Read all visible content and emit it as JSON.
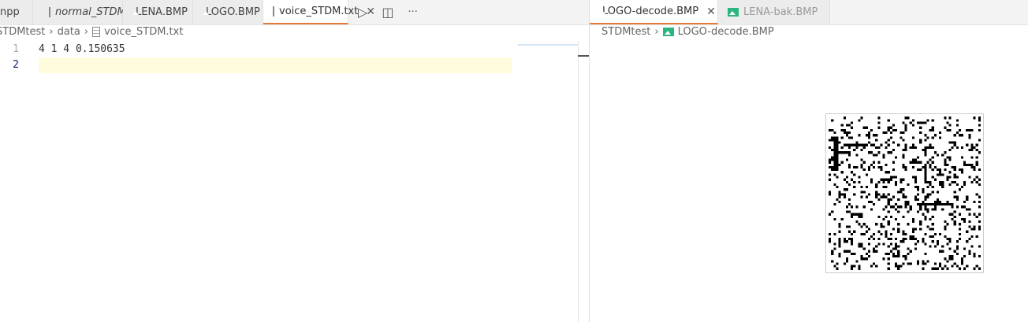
{
  "left_tabs": [
    {
      "label": "npp",
      "icon": "none"
    },
    {
      "label": "normal_STDM.txt",
      "icon": "file-icon",
      "italic": true
    },
    {
      "label": "LENA.BMP",
      "icon": "image-icon"
    },
    {
      "label": "LOGO.BMP",
      "icon": "image-icon"
    },
    {
      "label": "voice_STDM.txt",
      "icon": "file-icon",
      "active": true
    }
  ],
  "left_breadcrumb": [
    "STDMtest",
    "data",
    "voice_STDM.txt"
  ],
  "editor": {
    "lines": [
      {
        "n": "1",
        "text": "4 1 4 0.150635"
      },
      {
        "n": "2",
        "text": ""
      }
    ],
    "current_line": 2
  },
  "right_tabs": [
    {
      "label": "LOGO-decode.BMP",
      "active": true
    },
    {
      "label": "LENA-bak.BMP"
    }
  ],
  "right_breadcrumb": [
    "STDMtest",
    "LOGO-decode.BMP"
  ],
  "colors": {
    "accent": "#e67a3a",
    "image_icon": "#2bb57f",
    "current_line": "#fffbdd"
  }
}
